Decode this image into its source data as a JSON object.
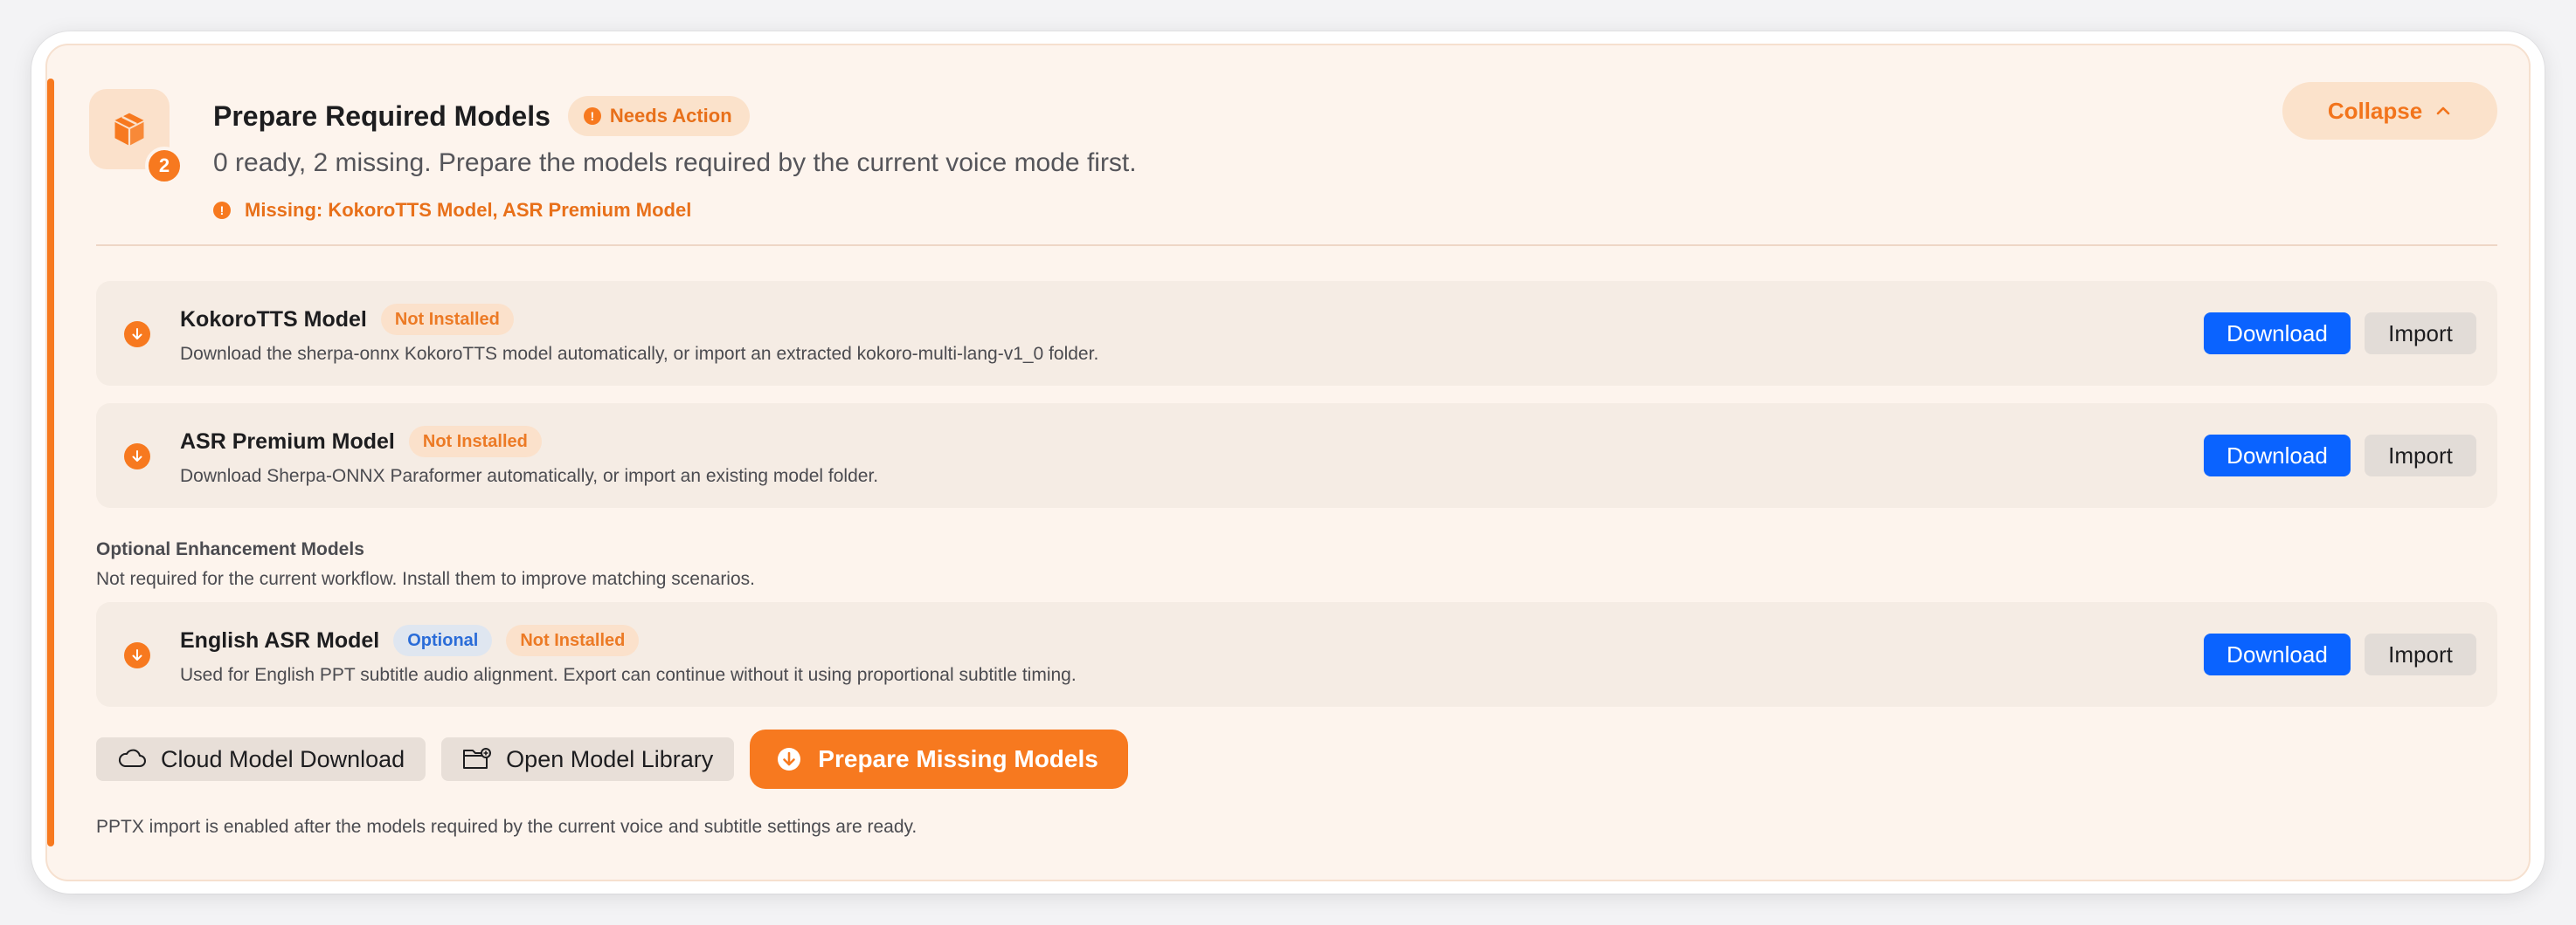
{
  "header": {
    "title": "Prepare Required Models",
    "badge_count": "2",
    "status_badge": "Needs Action",
    "summary": "0 ready, 2 missing. Prepare the models required by the current voice mode first.",
    "missing": "Missing: KokoroTTS Model, ASR Premium Model",
    "collapse_label": "Collapse"
  },
  "required_models": [
    {
      "name": "KokoroTTS Model",
      "status": "Not Installed",
      "description": "Download the sherpa-onnx KokoroTTS model automatically, or import an extracted kokoro-multi-lang-v1_0 folder.",
      "download_label": "Download",
      "import_label": "Import"
    },
    {
      "name": "ASR Premium Model",
      "status": "Not Installed",
      "description": "Download Sherpa-ONNX Paraformer automatically, or import an existing model folder.",
      "download_label": "Download",
      "import_label": "Import"
    }
  ],
  "optional": {
    "title": "Optional Enhancement Models",
    "description": "Not required for the current workflow. Install them to improve matching scenarios.",
    "models": [
      {
        "name": "English ASR Model",
        "tag": "Optional",
        "status": "Not Installed",
        "description": "Used for English PPT subtitle audio alignment. Export can continue without it using proportional subtitle timing.",
        "download_label": "Download",
        "import_label": "Import"
      }
    ]
  },
  "actions": {
    "cloud_download": "Cloud Model Download",
    "open_library": "Open Model Library",
    "prepare_missing": "Prepare Missing Models"
  },
  "footer_note": "PPTX import is enabled after the models required by the current voice and subtitle settings are ready.",
  "icons": {
    "package": "package-icon",
    "warning": "exclamation-circle-icon",
    "download": "arrow-down-circle-icon",
    "cloud": "cloud-icon",
    "folder": "folder-open-icon",
    "chevron": "chevron-up-icon"
  },
  "colors": {
    "accent": "#f7791f",
    "primary_blue": "#0a63ff",
    "card_bg": "#fdf4ed",
    "row_bg": "#f5ece4"
  }
}
